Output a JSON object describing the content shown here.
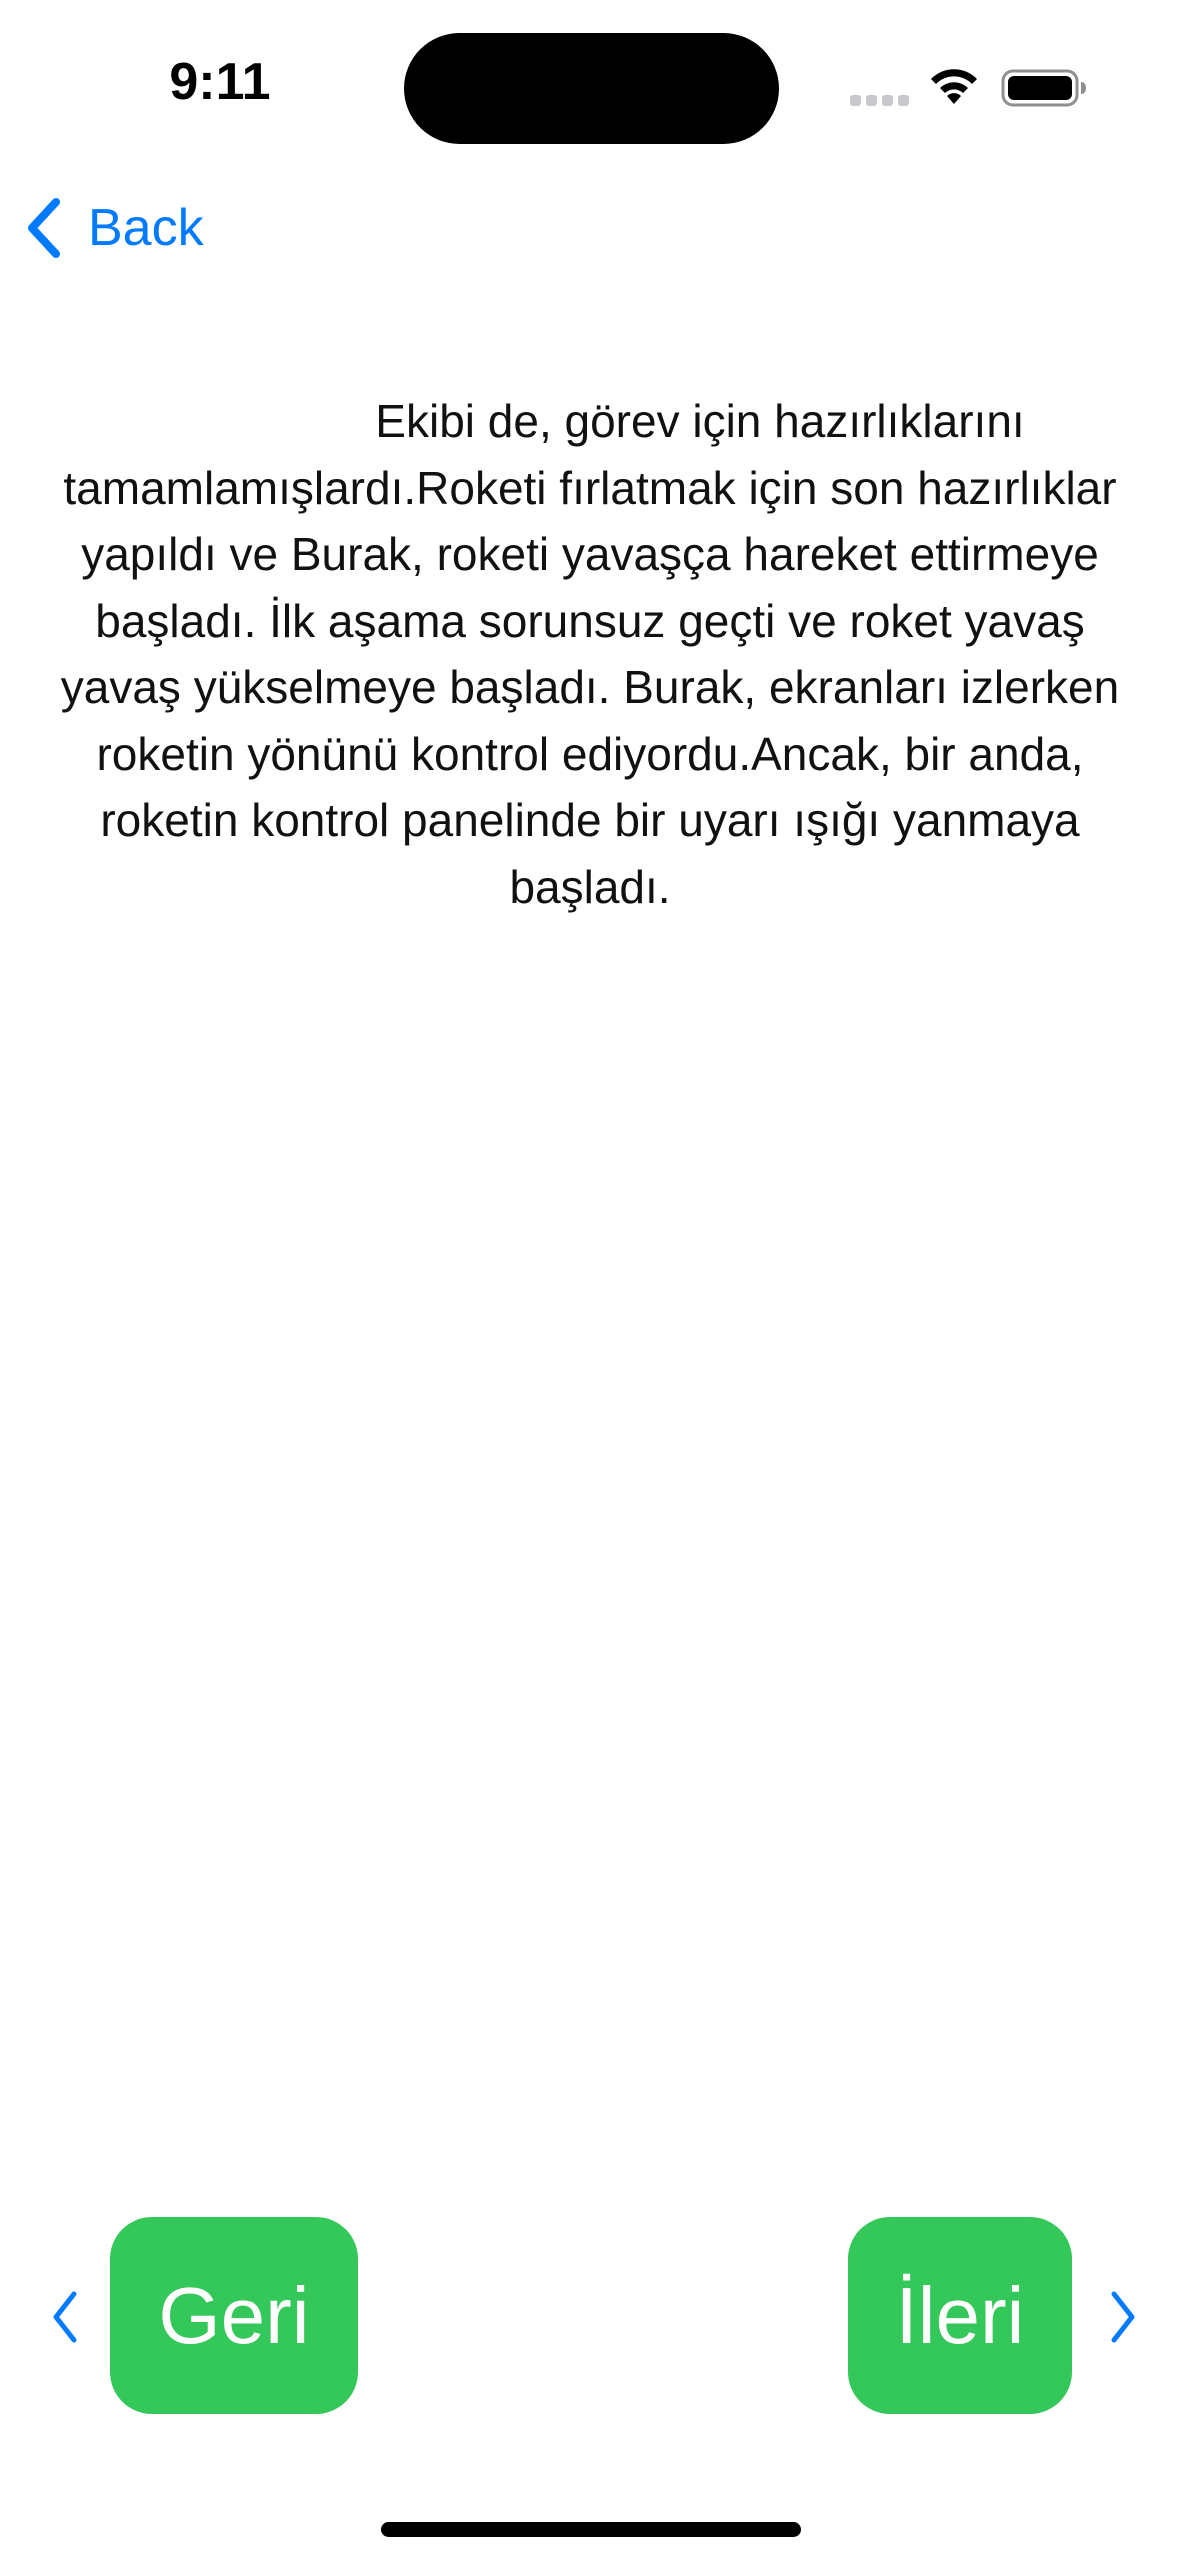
{
  "status_bar": {
    "time": "9:11",
    "icons": [
      "cellular-signal-icon",
      "wifi-icon",
      "battery-icon"
    ]
  },
  "nav": {
    "back_label": "Back",
    "back_icon": "chevron-left-icon",
    "accent_color": "#007AFF"
  },
  "story": {
    "text": "Ekibi de, görev için hazırlıklarını tamamlamışlardı.Roketi fırlatmak için son hazırlıklar yapıldı ve Burak, roketi yavaşça hareket ettirmeye başladı. İlk aşama sorunsuz geçti ve roket yavaş yavaş yükselmeye başladı. Burak, ekranları izlerken roketin yönünü kontrol ediyordu.Ancak, bir anda, roketin kontrol panelinde bir uyarı ışığı yanmaya başladı."
  },
  "controls": {
    "back_button_label": "Geri",
    "next_button_label": "İleri",
    "button_color": "#34C759",
    "left_icon": "chevron-left-icon",
    "right_icon": "chevron-right-icon"
  }
}
